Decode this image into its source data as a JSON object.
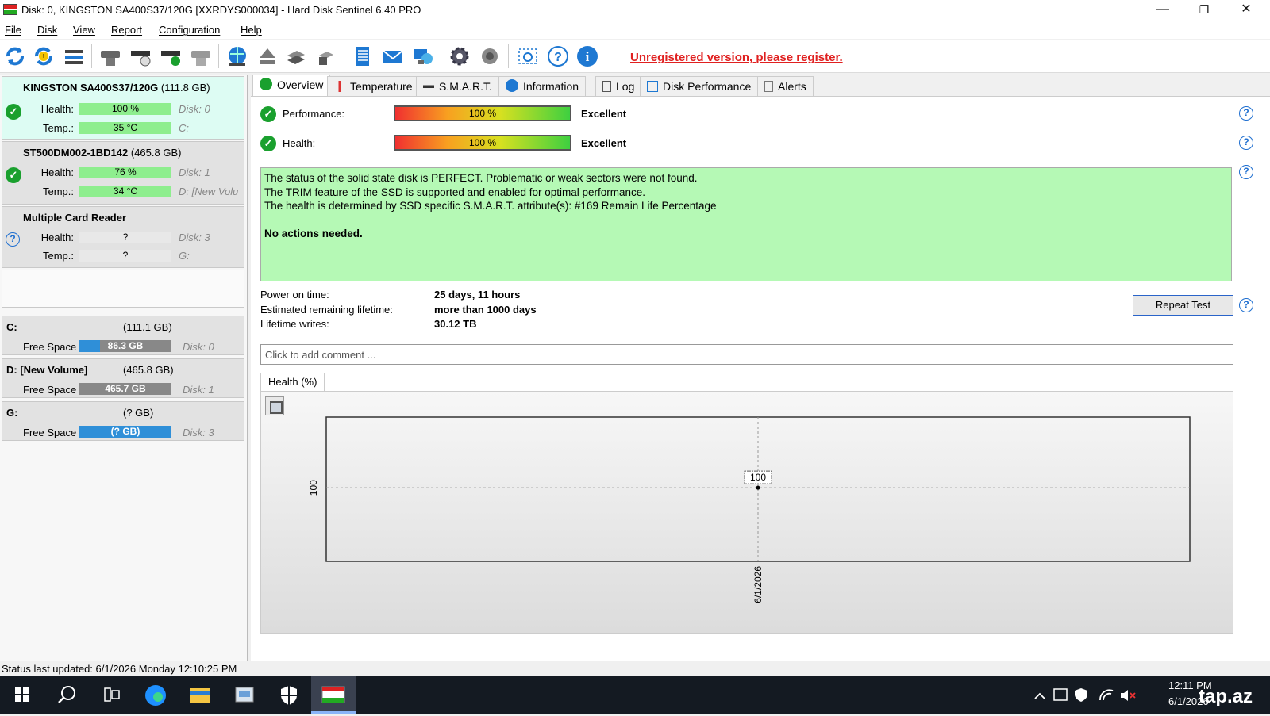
{
  "window": {
    "title": "Disk: 0, KINGSTON SA400S37/120G [XXRDYS000034]  -  Hard Disk Sentinel 6.40 PRO",
    "minimize": "—",
    "restore": "❐",
    "close": "✕"
  },
  "menu": [
    "File",
    "Disk",
    "View",
    "Report",
    "Configuration",
    "Help"
  ],
  "toolbar": {
    "register_link": "Unregistered version, please register."
  },
  "disks": [
    {
      "name": "KINGSTON SA400S37/120G",
      "size": "(111.8 GB)",
      "health_label": "Health:",
      "health": "100 %",
      "health_pct": 100,
      "disk_id": "Disk: 0",
      "temp_label": "Temp.:",
      "temp": "35 °C",
      "drive": "C:",
      "status_icon": "check-icon"
    },
    {
      "name": "ST500DM002-1BD142",
      "size": "(465.8 GB)",
      "health_label": "Health:",
      "health": "76 %",
      "health_pct": 76,
      "disk_id": "Disk: 1",
      "temp_label": "Temp.:",
      "temp": "34 °C",
      "drive": "D: [New Volu",
      "status_icon": "check-icon"
    },
    {
      "name": "Multiple Card  Reader",
      "size": "",
      "health_label": "Health:",
      "health": "?",
      "disk_id": "Disk: 3",
      "temp_label": "Temp.:",
      "temp": "?",
      "drive": "G:",
      "status_icon": "question-icon"
    }
  ],
  "volumes": [
    {
      "name": "C:",
      "size": "(111.1 GB)",
      "free_label": "Free Space",
      "free": "86.3 GB",
      "free_fill": 0.22,
      "disk": "Disk: 0"
    },
    {
      "name": "D: [New Volume]",
      "size": "(465.8 GB)",
      "free_label": "Free Space",
      "free": "465.7 GB",
      "free_fill": 0.0,
      "disk": "Disk: 1"
    },
    {
      "name": "G:",
      "size": "(? GB)",
      "free_label": "Free Space",
      "free": "(? GB)",
      "free_fill": 1.0,
      "disk": "Disk: 3"
    }
  ],
  "tabs": [
    "Overview",
    "Temperature",
    "S.M.A.R.T.",
    "Information",
    "Log",
    "Disk Performance",
    "Alerts"
  ],
  "overview": {
    "performance_label": "Performance:",
    "performance_value": "100 %",
    "performance_word": "Excellent",
    "health_label": "Health:",
    "health_value": "100 %",
    "health_word": "Excellent",
    "status_lines": [
      "The status of the solid state disk is PERFECT. Problematic or weak sectors were not found.",
      "The TRIM feature of the SSD is supported and enabled for optimal performance.",
      "The health is determined by SSD specific S.M.A.R.T. attribute(s):  #169 Remain Life Percentage"
    ],
    "status_action": "No actions needed.",
    "power_on_label": "Power on time:",
    "power_on_value": "25 days, 11 hours",
    "lifetime_label": "Estimated remaining lifetime:",
    "lifetime_value": "more than 1000 days",
    "writes_label": "Lifetime writes:",
    "writes_value": "30.12 TB",
    "repeat_test": "Repeat Test",
    "comment_placeholder": "Click to add comment ...",
    "chart_tab": "Health (%)"
  },
  "chart_data": {
    "type": "line",
    "x": [
      "6/1/2026"
    ],
    "series": [
      {
        "values": [
          100
        ]
      }
    ],
    "ylabel": "",
    "y_tick_labels": [
      "100"
    ],
    "data_labels": [
      "100"
    ]
  },
  "statusbar": "Status last updated: 6/1/2026 Monday 12:10:25 PM",
  "taskbar": {
    "time": "12:11 PM",
    "date": "6/1/2026",
    "watermark": "tap.az"
  }
}
